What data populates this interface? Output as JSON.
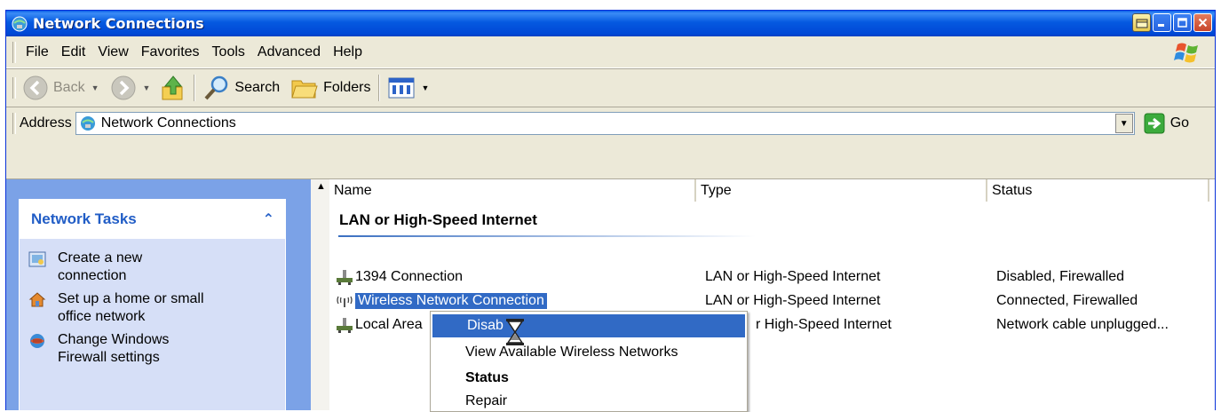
{
  "window": {
    "title": "Network Connections"
  },
  "menubar": {
    "items": [
      "File",
      "Edit",
      "View",
      "Favorites",
      "Tools",
      "Advanced",
      "Help"
    ]
  },
  "toolbar": {
    "back_label": "Back",
    "search_label": "Search",
    "folders_label": "Folders"
  },
  "addressbar": {
    "label": "Address",
    "value": "Network Connections",
    "go_label": "Go"
  },
  "leftpane": {
    "section_title": "Network Tasks",
    "collapse_glyph": "⌃",
    "tasks": [
      {
        "line1": "Create a new",
        "line2": "connection"
      },
      {
        "line1": "Set up a home or small",
        "line2": "office network"
      },
      {
        "line1": "Change Windows",
        "line2": "Firewall settings"
      }
    ]
  },
  "list": {
    "columns": [
      "Name",
      "Type",
      "Status"
    ],
    "group": "LAN or High-Speed Internet",
    "rows": [
      {
        "name": "1394 Connection",
        "type": "LAN or High-Speed Internet",
        "status": "Disabled, Firewalled"
      },
      {
        "name": "Wireless Network Connection",
        "type": "LAN or High-Speed Internet",
        "status": "Connected, Firewalled"
      },
      {
        "name": "Local Area",
        "type": "r High-Speed Internet",
        "status": "Network cable unplugged..."
      }
    ]
  },
  "context_menu": {
    "items": [
      "Disab",
      "View Available Wireless Networks",
      "Status",
      "Repair"
    ]
  },
  "colors": {
    "titlebar": "#0559e0",
    "selection": "#316ac5",
    "taskpane": "#7ba2e7",
    "task_header_text": "#215dc6"
  }
}
